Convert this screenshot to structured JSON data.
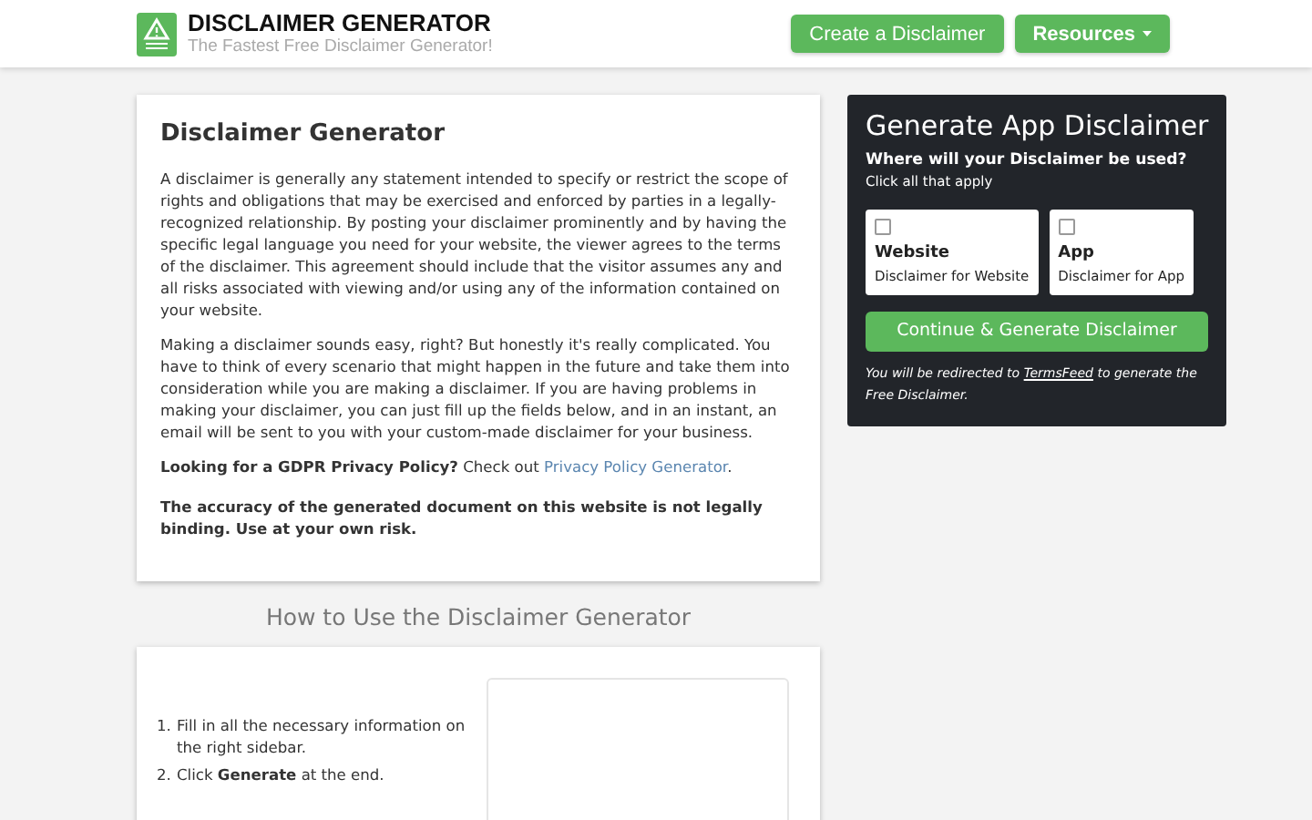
{
  "header": {
    "brand": "DISCLAIMER GENERATOR",
    "tagline": "The Fastest Free Disclaimer Generator!",
    "nav": [
      {
        "label": "Create a Disclaimer",
        "kind": "plain"
      },
      {
        "label": "Resources",
        "kind": "dropdown"
      }
    ]
  },
  "intro": {
    "title": "Disclaimer Generator",
    "paragraphs": [
      "A disclaimer is generally any statement intended to specify or restrict the scope of rights and obligations that may be exercised and enforced by parties in a legally-recognized relationship. By posting your disclaimer prominently and by having the specific legal language you need for your website, the viewer agrees to the terms of the disclaimer. This agreement should include that the visitor assumes any and all risks associated with viewing and/or using any of the information contained on your website.",
      "Making a disclaimer sounds easy, right? But honestly it's really complicated. You have to think of every scenario that might happen in the future and take them into consideration while you are making a disclaimer. If you are having problems in making your disclaimer, you can just fill up the fields below, and in an instant, an email will be sent to you with your custom-made disclaimer for your business."
    ],
    "gdpr": {
      "lead": "Looking for a GDPR Privacy Policy?",
      "text": "Check out",
      "link": "Privacy Policy Generator",
      "tail": "."
    },
    "warning": "The accuracy of the generated document on this website is not legally binding. Use at your own risk."
  },
  "howto": {
    "title": "How to Use the Disclaimer Generator",
    "steps": [
      {
        "marker": "1.",
        "text": "Fill in all the necessary information on the right sidebar."
      },
      {
        "marker": "2.",
        "text": "Click **Generate** at the end."
      }
    ]
  },
  "sidebar": {
    "title": "Generate App Disclaimer",
    "question": "Where will your Disclaimer be used?",
    "hint": "Click all that apply",
    "options": [
      {
        "title": "Website",
        "subtitle": "Disclaimer for Website",
        "checked": false
      },
      {
        "title": "App",
        "subtitle": "Disclaimer for App",
        "checked": false
      }
    ],
    "button": "Continue & Generate Disclaimer",
    "note": "You will be redirected to",
    "note_link": "TermsFeed",
    "note_tail": "to generate the Free Disclaimer."
  }
}
